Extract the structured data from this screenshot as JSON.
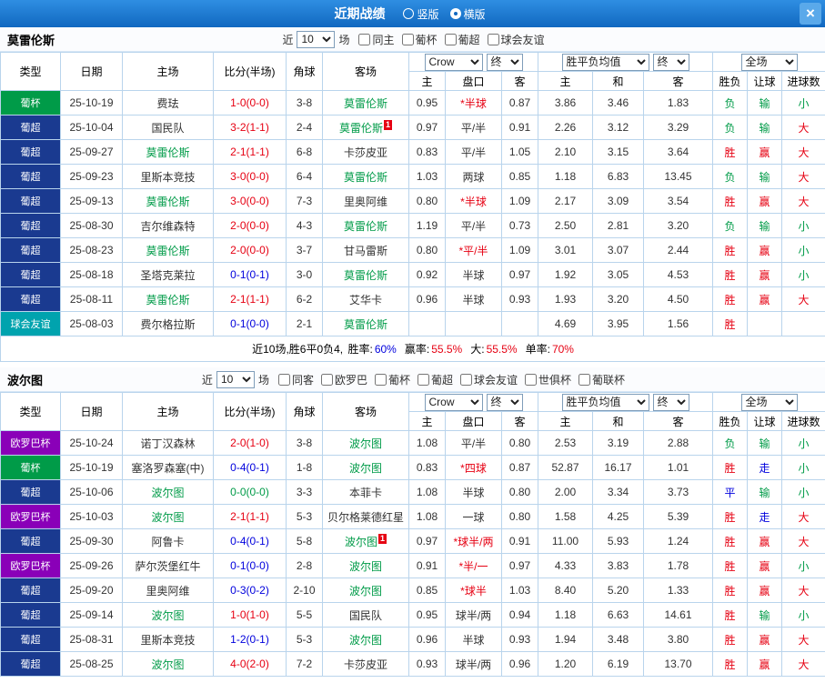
{
  "titlebar": {
    "title": "近期战绩",
    "radio_vertical": "竖版",
    "radio_horizontal": "横版",
    "close_icon": "×"
  },
  "colors": {
    "league": {
      "葡杯": "#009b48",
      "葡超": "#1a3a90",
      "球会友谊": "#00a3ae",
      "欧罗巴杯": "#8a00b8"
    },
    "result": {
      "胜": "#e60012",
      "平": "#0000dd",
      "负": "#009b48",
      "赢": "#e60012",
      "走": "#0000dd",
      "输": "#009b48",
      "大": "#e60012",
      "小": "#009b48"
    },
    "score": {
      "home_win": "#e60012",
      "away_win": "#0000dd",
      "draw": "#009b48"
    },
    "team_name": "#009b48",
    "handicap_star": "#e60012"
  },
  "filter_labels": {
    "near": "近",
    "games": "场"
  },
  "table_columns": [
    "类型",
    "日期",
    "主场",
    "比分(半场)",
    "角球",
    "客场",
    "主",
    "盘口",
    "客",
    "主",
    "和",
    "客",
    "胜负",
    "让球",
    "进球数"
  ],
  "sections": [
    {
      "team": "莫雷伦斯",
      "filter": {
        "count": "10",
        "checkboxes": [
          "同主",
          "葡杯",
          "葡超",
          "球会友谊"
        ]
      },
      "dropdowns": {
        "company": "Crow",
        "company_state": "终",
        "avg": "胜平负均值",
        "avg_state": "终",
        "scope": "全场"
      },
      "rows": [
        {
          "league": "葡杯",
          "date": "25-10-19",
          "home": "费珐",
          "home_team": false,
          "home_badge": "",
          "score": "1-0(0-0)",
          "score_type": "home_win",
          "corner": "3-8",
          "away": "莫雷伦斯",
          "away_team": true,
          "away_badge": "",
          "odds_home": "0.95",
          "handicap": "*半球",
          "odds_away": "0.87",
          "avg_home": "3.86",
          "avg_draw": "3.46",
          "avg_away": "1.83",
          "result": "负",
          "handicap_result": "输",
          "goals_result": "小"
        },
        {
          "league": "葡超",
          "date": "25-10-04",
          "home": "国民队",
          "home_team": false,
          "home_badge": "",
          "score": "3-2(1-1)",
          "score_type": "home_win",
          "corner": "2-4",
          "away": "莫雷伦斯",
          "away_team": true,
          "away_badge": "1",
          "odds_home": "0.97",
          "handicap": "平/半",
          "odds_away": "0.91",
          "avg_home": "2.26",
          "avg_draw": "3.12",
          "avg_away": "3.29",
          "result": "负",
          "handicap_result": "输",
          "goals_result": "大"
        },
        {
          "league": "葡超",
          "date": "25-09-27",
          "home": "莫雷伦斯",
          "home_team": true,
          "home_badge": "",
          "score": "2-1(1-1)",
          "score_type": "home_win",
          "corner": "6-8",
          "away": "卡莎皮亚",
          "away_team": false,
          "away_badge": "",
          "odds_home": "0.83",
          "handicap": "平/半",
          "odds_away": "1.05",
          "avg_home": "2.10",
          "avg_draw": "3.15",
          "avg_away": "3.64",
          "result": "胜",
          "handicap_result": "赢",
          "goals_result": "大"
        },
        {
          "league": "葡超",
          "date": "25-09-23",
          "home": "里斯本竞技",
          "home_team": false,
          "home_badge": "",
          "score": "3-0(0-0)",
          "score_type": "home_win",
          "corner": "6-4",
          "away": "莫雷伦斯",
          "away_team": true,
          "away_badge": "",
          "odds_home": "1.03",
          "handicap": "两球",
          "odds_away": "0.85",
          "avg_home": "1.18",
          "avg_draw": "6.83",
          "avg_away": "13.45",
          "result": "负",
          "handicap_result": "输",
          "goals_result": "大"
        },
        {
          "league": "葡超",
          "date": "25-09-13",
          "home": "莫雷伦斯",
          "home_team": true,
          "home_badge": "",
          "score": "3-0(0-0)",
          "score_type": "home_win",
          "corner": "7-3",
          "away": "里奥阿维",
          "away_team": false,
          "away_badge": "",
          "odds_home": "0.80",
          "handicap": "*半球",
          "odds_away": "1.09",
          "avg_home": "2.17",
          "avg_draw": "3.09",
          "avg_away": "3.54",
          "result": "胜",
          "handicap_result": "赢",
          "goals_result": "大"
        },
        {
          "league": "葡超",
          "date": "25-08-30",
          "home": "吉尔维森特",
          "home_team": false,
          "home_badge": "",
          "score": "2-0(0-0)",
          "score_type": "home_win",
          "corner": "4-3",
          "away": "莫雷伦斯",
          "away_team": true,
          "away_badge": "",
          "odds_home": "1.19",
          "handicap": "平/半",
          "odds_away": "0.73",
          "avg_home": "2.50",
          "avg_draw": "2.81",
          "avg_away": "3.20",
          "result": "负",
          "handicap_result": "输",
          "goals_result": "小"
        },
        {
          "league": "葡超",
          "date": "25-08-23",
          "home": "莫雷伦斯",
          "home_team": true,
          "home_badge": "",
          "score": "2-0(0-0)",
          "score_type": "home_win",
          "corner": "3-7",
          "away": "甘马雷斯",
          "away_team": false,
          "away_badge": "",
          "odds_home": "0.80",
          "handicap": "*平/半",
          "odds_away": "1.09",
          "avg_home": "3.01",
          "avg_draw": "3.07",
          "avg_away": "2.44",
          "result": "胜",
          "handicap_result": "赢",
          "goals_result": "小"
        },
        {
          "league": "葡超",
          "date": "25-08-18",
          "home": "圣塔克莱拉",
          "home_team": false,
          "home_badge": "",
          "score": "0-1(0-1)",
          "score_type": "away_win",
          "corner": "3-0",
          "away": "莫雷伦斯",
          "away_team": true,
          "away_badge": "",
          "odds_home": "0.92",
          "handicap": "半球",
          "odds_away": "0.97",
          "avg_home": "1.92",
          "avg_draw": "3.05",
          "avg_away": "4.53",
          "result": "胜",
          "handicap_result": "赢",
          "goals_result": "小"
        },
        {
          "league": "葡超",
          "date": "25-08-11",
          "home": "莫雷伦斯",
          "home_team": true,
          "home_badge": "",
          "score": "2-1(1-1)",
          "score_type": "home_win",
          "corner": "6-2",
          "away": "艾华卡",
          "away_team": false,
          "away_badge": "",
          "odds_home": "0.96",
          "handicap": "半球",
          "odds_away": "0.93",
          "avg_home": "1.93",
          "avg_draw": "3.20",
          "avg_away": "4.50",
          "result": "胜",
          "handicap_result": "赢",
          "goals_result": "大"
        },
        {
          "league": "球会友谊",
          "date": "25-08-03",
          "home": "费尔格拉斯",
          "home_team": false,
          "home_badge": "",
          "score": "0-1(0-0)",
          "score_type": "away_win",
          "corner": "2-1",
          "away": "莫雷伦斯",
          "away_team": true,
          "away_badge": "",
          "odds_home": "",
          "handicap": "",
          "odds_away": "",
          "avg_home": "4.69",
          "avg_draw": "3.95",
          "avg_away": "1.56",
          "result": "胜",
          "handicap_result": "",
          "goals_result": ""
        }
      ],
      "summary": {
        "prefix": "近10场,胜6平0负4, ",
        "stats": [
          {
            "label": "胜率:",
            "value": "60%",
            "color": "#0000dd"
          },
          {
            "label": "赢率:",
            "value": "55.5%",
            "color": "#e60012"
          },
          {
            "label": "大:",
            "value": "55.5%",
            "color": "#e60012"
          },
          {
            "label": "单率:",
            "value": "70%",
            "color": "#e60012"
          }
        ]
      }
    },
    {
      "team": "波尔图",
      "filter": {
        "count": "10",
        "checkboxes": [
          "同客",
          "欧罗巴",
          "葡杯",
          "葡超",
          "球会友谊",
          "世俱杯",
          "葡联杯"
        ]
      },
      "dropdowns": {
        "company": "Crow",
        "company_state": "终",
        "avg": "胜平负均值",
        "avg_state": "终",
        "scope": "全场"
      },
      "rows": [
        {
          "league": "欧罗巴杯",
          "date": "25-10-24",
          "home": "诺丁汉森林",
          "home_team": false,
          "home_badge": "",
          "score": "2-0(1-0)",
          "score_type": "home_win",
          "corner": "3-8",
          "away": "波尔图",
          "away_team": true,
          "away_badge": "",
          "odds_home": "1.08",
          "handicap": "平/半",
          "odds_away": "0.80",
          "avg_home": "2.53",
          "avg_draw": "3.19",
          "avg_away": "2.88",
          "result": "负",
          "handicap_result": "输",
          "goals_result": "小"
        },
        {
          "league": "葡杯",
          "date": "25-10-19",
          "home": "塞洛罗森塞(中)",
          "home_team": false,
          "home_badge": "",
          "score": "0-4(0-1)",
          "score_type": "away_win",
          "corner": "1-8",
          "away": "波尔图",
          "away_team": true,
          "away_badge": "",
          "odds_home": "0.83",
          "handicap": "*四球",
          "odds_away": "0.87",
          "avg_home": "52.87",
          "avg_draw": "16.17",
          "avg_away": "1.01",
          "result": "胜",
          "handicap_result": "走",
          "goals_result": "小"
        },
        {
          "league": "葡超",
          "date": "25-10-06",
          "home": "波尔图",
          "home_team": true,
          "home_badge": "",
          "score": "0-0(0-0)",
          "score_type": "draw",
          "corner": "3-3",
          "away": "本菲卡",
          "away_team": false,
          "away_badge": "",
          "odds_home": "1.08",
          "handicap": "半球",
          "odds_away": "0.80",
          "avg_home": "2.00",
          "avg_draw": "3.34",
          "avg_away": "3.73",
          "result": "平",
          "handicap_result": "输",
          "goals_result": "小"
        },
        {
          "league": "欧罗巴杯",
          "date": "25-10-03",
          "home": "波尔图",
          "home_team": true,
          "home_badge": "",
          "score": "2-1(1-1)",
          "score_type": "home_win",
          "corner": "5-3",
          "away": "贝尔格莱德红星",
          "away_team": false,
          "away_badge": "",
          "odds_home": "1.08",
          "handicap": "一球",
          "odds_away": "0.80",
          "avg_home": "1.58",
          "avg_draw": "4.25",
          "avg_away": "5.39",
          "result": "胜",
          "handicap_result": "走",
          "goals_result": "大"
        },
        {
          "league": "葡超",
          "date": "25-09-30",
          "home": "阿鲁卡",
          "home_team": false,
          "home_badge": "",
          "score": "0-4(0-1)",
          "score_type": "away_win",
          "corner": "5-8",
          "away": "波尔图",
          "away_team": true,
          "away_badge": "1",
          "odds_home": "0.97",
          "handicap": "*球半/两",
          "odds_away": "0.91",
          "avg_home": "11.00",
          "avg_draw": "5.93",
          "avg_away": "1.24",
          "result": "胜",
          "handicap_result": "赢",
          "goals_result": "大"
        },
        {
          "league": "欧罗巴杯",
          "date": "25-09-26",
          "home": "萨尔茨堡红牛",
          "home_team": false,
          "home_badge": "",
          "score": "0-1(0-0)",
          "score_type": "away_win",
          "corner": "2-8",
          "away": "波尔图",
          "away_team": true,
          "away_badge": "",
          "odds_home": "0.91",
          "handicap": "*半/一",
          "odds_away": "0.97",
          "avg_home": "4.33",
          "avg_draw": "3.83",
          "avg_away": "1.78",
          "result": "胜",
          "handicap_result": "赢",
          "goals_result": "小"
        },
        {
          "league": "葡超",
          "date": "25-09-20",
          "home": "里奥阿维",
          "home_team": false,
          "home_badge": "",
          "score": "0-3(0-2)",
          "score_type": "away_win",
          "corner": "2-10",
          "away": "波尔图",
          "away_team": true,
          "away_badge": "",
          "odds_home": "0.85",
          "handicap": "*球半",
          "odds_away": "1.03",
          "avg_home": "8.40",
          "avg_draw": "5.20",
          "avg_away": "1.33",
          "result": "胜",
          "handicap_result": "赢",
          "goals_result": "大"
        },
        {
          "league": "葡超",
          "date": "25-09-14",
          "home": "波尔图",
          "home_team": true,
          "home_badge": "",
          "score": "1-0(1-0)",
          "score_type": "home_win",
          "corner": "5-5",
          "away": "国民队",
          "away_team": false,
          "away_badge": "",
          "odds_home": "0.95",
          "handicap": "球半/两",
          "odds_away": "0.94",
          "avg_home": "1.18",
          "avg_draw": "6.63",
          "avg_away": "14.61",
          "result": "胜",
          "handicap_result": "输",
          "goals_result": "小"
        },
        {
          "league": "葡超",
          "date": "25-08-31",
          "home": "里斯本竞技",
          "home_team": false,
          "home_badge": "",
          "score": "1-2(0-1)",
          "score_type": "away_win",
          "corner": "5-3",
          "away": "波尔图",
          "away_team": true,
          "away_badge": "",
          "odds_home": "0.96",
          "handicap": "半球",
          "odds_away": "0.93",
          "avg_home": "1.94",
          "avg_draw": "3.48",
          "avg_away": "3.80",
          "result": "胜",
          "handicap_result": "赢",
          "goals_result": "大"
        },
        {
          "league": "葡超",
          "date": "25-08-25",
          "home": "波尔图",
          "home_team": true,
          "home_badge": "",
          "score": "4-0(2-0)",
          "score_type": "home_win",
          "corner": "7-2",
          "away": "卡莎皮亚",
          "away_team": false,
          "away_badge": "",
          "odds_home": "0.93",
          "handicap": "球半/两",
          "odds_away": "0.96",
          "avg_home": "1.20",
          "avg_draw": "6.19",
          "avg_away": "13.70",
          "result": "胜",
          "handicap_result": "赢",
          "goals_result": "大"
        }
      ],
      "summary": null
    }
  ]
}
